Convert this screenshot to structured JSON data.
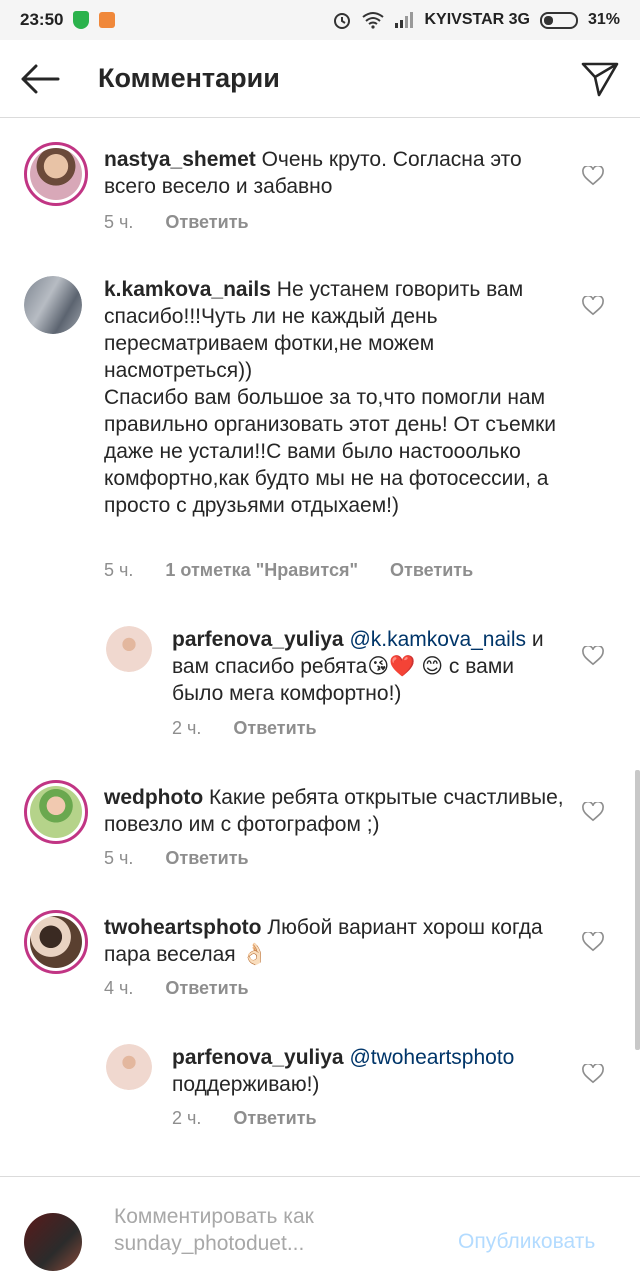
{
  "status_bar": {
    "time": "23:50",
    "carrier": "KYIVSTAR 3G",
    "battery": "31%"
  },
  "header": {
    "title": "Комментарии"
  },
  "comments": [
    {
      "username": "nastya_shemet",
      "text": "Очень круто.  Согласна это всего весело и забавно",
      "time": "5 ч.",
      "likes": "",
      "reply": "Ответить"
    },
    {
      "username": "k.kamkova_nails",
      "text": "Не устанем говорить вам спасибо!!!Чуть ли не каждый день пересматриваем фотки,не  можем насмотреться))\nСпасибо вам большое за то,что помогли нам правильно организовать этот день! От съемки даже не устали!!С вами было настооолько комфортно,как будто мы не на фотосессии, а  просто  с друзьями отдыхаем!)",
      "time": "5 ч.",
      "likes": "1 отметка \"Нравится\"",
      "reply": "Ответить"
    },
    {
      "username": "parfenova_yuliya",
      "mention": "@k.kamkova_nails",
      "text": "и вам  спасибо ребята😘❤️ 😊 с вами было мега комфортно!)",
      "time": "2 ч.",
      "likes": "",
      "reply": "Ответить"
    },
    {
      "username": "wedphoto",
      "text": "Какие ребята открытые счастливые, повезло им с фотографом ;)",
      "time": "5 ч.",
      "likes": "",
      "reply": "Ответить"
    },
    {
      "username": "twoheartsphoto",
      "text": "Любой вариант хорош когда пара веселая 👌🏻",
      "time": "4 ч.",
      "likes": "",
      "reply": "Ответить"
    },
    {
      "username": "parfenova_yuliya",
      "mention": "@twoheartsphoto",
      "text": "поддерживаю!)",
      "time": "2 ч.",
      "likes": "",
      "reply": "Ответить"
    }
  ],
  "input": {
    "placeholder": "Комментировать как sunday_photoduet...",
    "publish_label": "Опубликовать"
  },
  "colors": {
    "accent": "#3897f0",
    "publish_disabled": "#b3dbff",
    "story_ring": "#c13584",
    "text": "#262626",
    "muted": "#8e8e8e"
  }
}
